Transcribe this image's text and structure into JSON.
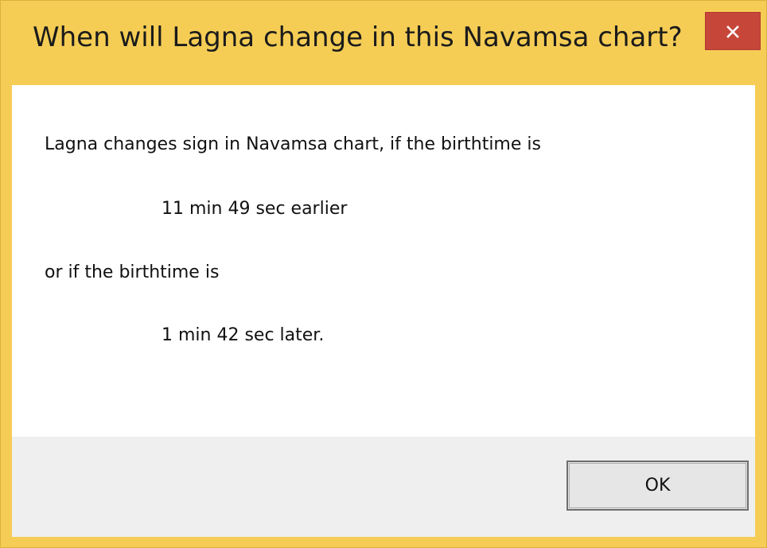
{
  "dialog": {
    "title": "When will Lagna change in this Navamsa chart?",
    "close_icon": "close-icon",
    "message": {
      "line1": "Lagna changes sign in Navamsa chart, if the birthtime is",
      "line2": "11 min 49 sec earlier",
      "line3": "or if the birthtime is",
      "line4": "1 min 42 sec later."
    },
    "ok_label": "OK"
  },
  "colors": {
    "frame": "#f5cd55",
    "close_button": "#c7463a",
    "footer": "#efefef"
  }
}
